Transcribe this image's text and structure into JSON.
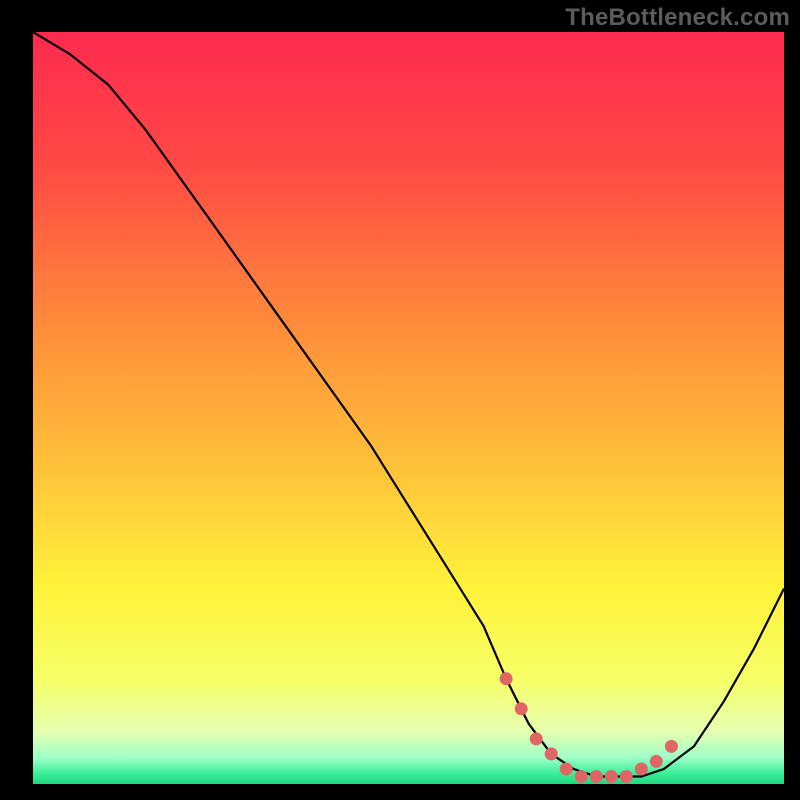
{
  "watermark": "TheBottleneck.com",
  "colors": {
    "background": "#000000",
    "curve": "#000000",
    "dots": "#e06666",
    "gradient_stops": [
      {
        "offset": 0.0,
        "color": "#ff2a4f"
      },
      {
        "offset": 0.18,
        "color": "#ff4a44"
      },
      {
        "offset": 0.4,
        "color": "#ff8f3a"
      },
      {
        "offset": 0.58,
        "color": "#ffc23a"
      },
      {
        "offset": 0.74,
        "color": "#fff33a"
      },
      {
        "offset": 0.86,
        "color": "#f6ff66"
      },
      {
        "offset": 0.93,
        "color": "#e6ffb0"
      },
      {
        "offset": 0.965,
        "color": "#9effc7"
      },
      {
        "offset": 0.985,
        "color": "#3ef09a"
      },
      {
        "offset": 1.0,
        "color": "#1fd880"
      }
    ]
  },
  "chart_data": {
    "type": "line",
    "title": "",
    "xlabel": "",
    "ylabel": "",
    "xlim": [
      0,
      100
    ],
    "ylim": [
      0,
      100
    ],
    "legend": false,
    "grid": false,
    "series": [
      {
        "name": "bottleneck-curve",
        "x": [
          0,
          5,
          10,
          15,
          20,
          25,
          30,
          35,
          40,
          45,
          50,
          55,
          60,
          63,
          66,
          69,
          72,
          75,
          78,
          81,
          84,
          88,
          92,
          96,
          100
        ],
        "y": [
          100,
          97,
          93,
          87,
          80,
          73,
          66,
          59,
          52,
          45,
          37,
          29,
          21,
          14,
          8,
          4,
          2,
          1,
          1,
          1,
          2,
          5,
          11,
          18,
          26
        ]
      }
    ],
    "highlight_dots": {
      "name": "optimal-range",
      "x": [
        63,
        65,
        67,
        69,
        71,
        73,
        75,
        77,
        79,
        81,
        83,
        85
      ],
      "y": [
        14,
        10,
        6,
        4,
        2,
        1,
        1,
        1,
        1,
        2,
        3,
        5
      ]
    },
    "annotations": []
  }
}
